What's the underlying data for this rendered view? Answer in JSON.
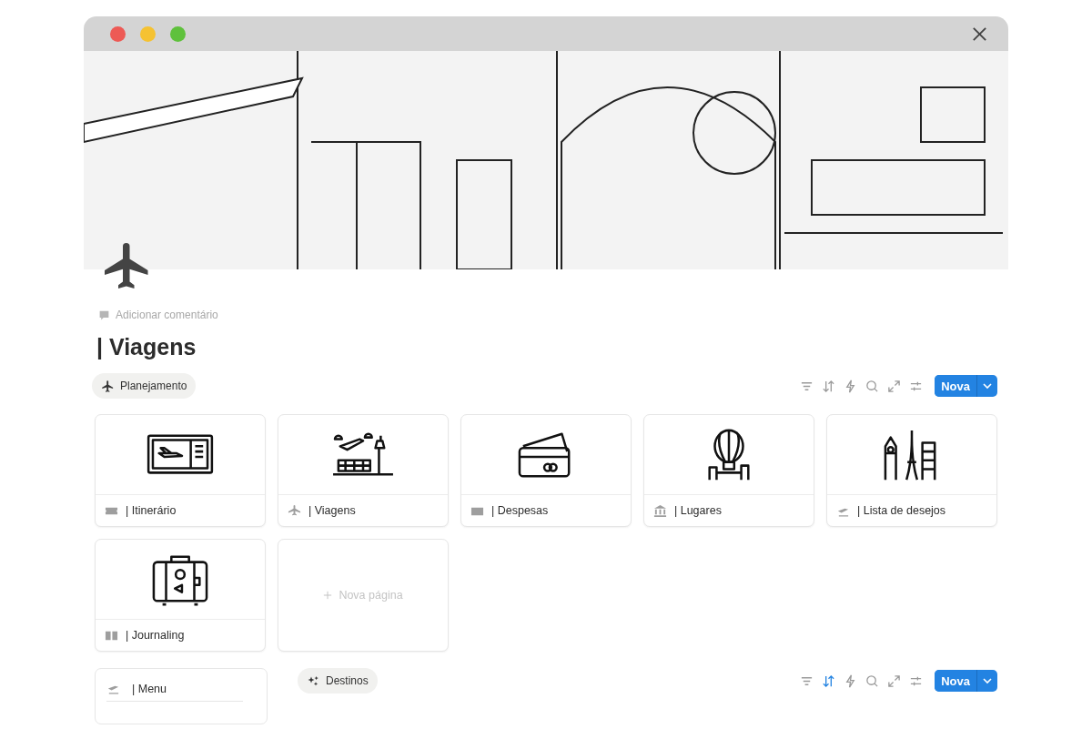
{
  "window": {
    "controls": [
      {
        "color": "#ed5a55"
      },
      {
        "color": "#f5c232"
      },
      {
        "color": "#5fc13c"
      }
    ]
  },
  "comment": "Adicionar comentário",
  "title": "| Viagens",
  "section": {
    "chip": {
      "label": "Planejamento",
      "kind": "plane"
    },
    "tools": [
      {
        "kind": "filter",
        "active": false
      },
      {
        "kind": "sort",
        "active": false
      },
      {
        "kind": "bolt",
        "active": false
      },
      {
        "kind": "search",
        "active": false
      },
      {
        "kind": "expand",
        "active": false
      },
      {
        "kind": "sliders",
        "active": false
      }
    ],
    "button": "Nova",
    "cards": [
      {
        "kind": "ticket",
        "title": "| Itinerário"
      },
      {
        "kind": "airport",
        "title": "| Viagens"
      },
      {
        "kind": "card",
        "title": "| Despesas"
      },
      {
        "kind": "balloon",
        "title": "| Lugares"
      },
      {
        "kind": "landmarks",
        "title": "| Lista de desejos"
      },
      {
        "kind": "suitcase",
        "title": "| Journaling"
      }
    ],
    "new_page": "Nova página"
  },
  "menu": {
    "title": "| Menu"
  },
  "section2": {
    "chip": {
      "label": "Destinos",
      "kind": "sparkle"
    },
    "tools": [
      {
        "kind": "filter",
        "active": false
      },
      {
        "kind": "sort",
        "active": true
      },
      {
        "kind": "bolt",
        "active": false
      },
      {
        "kind": "search",
        "active": false
      },
      {
        "kind": "expand",
        "active": false
      },
      {
        "kind": "sliders",
        "active": false
      }
    ],
    "button": "Nova"
  }
}
